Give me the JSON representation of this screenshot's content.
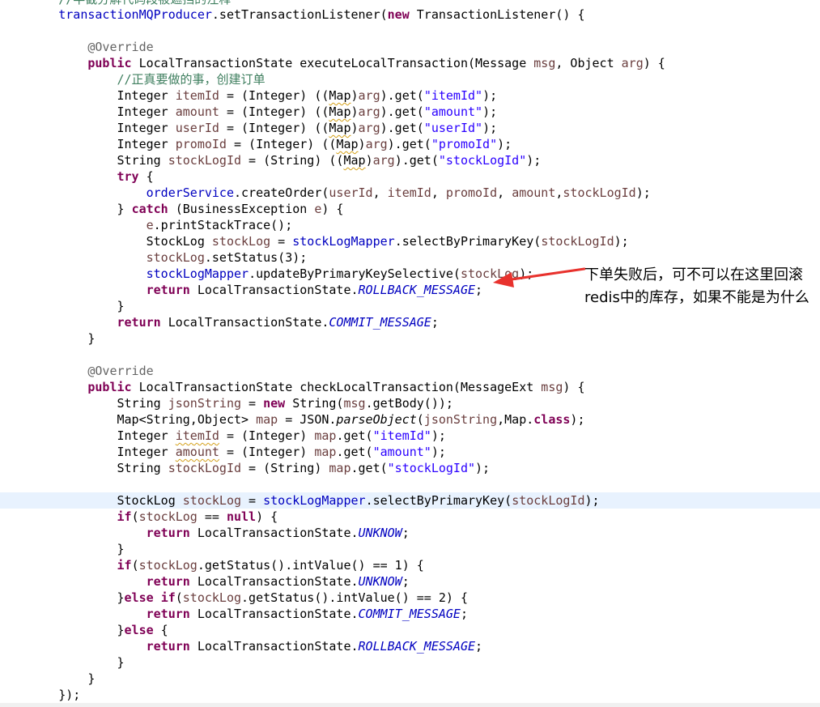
{
  "colors": {
    "keyword": "#7f0055",
    "field": "#0000c0",
    "string": "#2a00ff",
    "local_var": "#6a3e3e",
    "annotation": "#646464",
    "comment": "#3f7f5f",
    "current_line": "#e8f2fe",
    "arrow": "#e8322d"
  },
  "annotation": {
    "note": "下单失败后，可不可以在这里回滚redis中的库存，如果不能是为什么",
    "arrow_icon": "red-arrow-icon"
  },
  "code_lines": [
    [
      {
        "t": "        //半截分解代码段被遮挡的注释",
        "c": "cmt"
      }
    ],
    [
      {
        "t": "        "
      },
      {
        "t": "transactionMQProducer",
        "c": "fld"
      },
      {
        "t": ".setTransactionListener("
      },
      {
        "t": "new",
        "c": "kw"
      },
      {
        "t": " TransactionListener() {"
      }
    ],
    [],
    [
      {
        "t": "            "
      },
      {
        "t": "@Override",
        "c": "ann"
      }
    ],
    [
      {
        "t": "            "
      },
      {
        "t": "public",
        "c": "kw"
      },
      {
        "t": " LocalTransactionState executeLocalTransaction(Message "
      },
      {
        "t": "msg",
        "c": "loc"
      },
      {
        "t": ", Object "
      },
      {
        "t": "arg",
        "c": "loc"
      },
      {
        "t": ") {"
      }
    ],
    [
      {
        "t": "                "
      },
      {
        "t": "//正真要做的事，创建订单",
        "c": "cmt"
      }
    ],
    [
      {
        "t": "                Integer "
      },
      {
        "t": "itemId",
        "c": "loc"
      },
      {
        "t": " = (Integer) (("
      },
      {
        "t": "Map",
        "c": "warn"
      },
      {
        "t": ")"
      },
      {
        "t": "arg",
        "c": "loc"
      },
      {
        "t": ").get("
      },
      {
        "t": "\"itemId\"",
        "c": "str"
      },
      {
        "t": ");"
      }
    ],
    [
      {
        "t": "                Integer "
      },
      {
        "t": "amount",
        "c": "loc"
      },
      {
        "t": " = (Integer) (("
      },
      {
        "t": "Map",
        "c": "warn"
      },
      {
        "t": ")"
      },
      {
        "t": "arg",
        "c": "loc"
      },
      {
        "t": ").get("
      },
      {
        "t": "\"amount\"",
        "c": "str"
      },
      {
        "t": ");"
      }
    ],
    [
      {
        "t": "                Integer "
      },
      {
        "t": "userId",
        "c": "loc"
      },
      {
        "t": " = (Integer) (("
      },
      {
        "t": "Map",
        "c": "warn"
      },
      {
        "t": ")"
      },
      {
        "t": "arg",
        "c": "loc"
      },
      {
        "t": ").get("
      },
      {
        "t": "\"userId\"",
        "c": "str"
      },
      {
        "t": ");"
      }
    ],
    [
      {
        "t": "                Integer "
      },
      {
        "t": "promoId",
        "c": "loc"
      },
      {
        "t": " = (Integer) (("
      },
      {
        "t": "Map",
        "c": "warn"
      },
      {
        "t": ")"
      },
      {
        "t": "arg",
        "c": "loc"
      },
      {
        "t": ").get("
      },
      {
        "t": "\"promoId\"",
        "c": "str"
      },
      {
        "t": ");"
      }
    ],
    [
      {
        "t": "                String "
      },
      {
        "t": "stockLogId",
        "c": "loc"
      },
      {
        "t": " = (String) (("
      },
      {
        "t": "Map",
        "c": "warn"
      },
      {
        "t": ")"
      },
      {
        "t": "arg",
        "c": "loc"
      },
      {
        "t": ").get("
      },
      {
        "t": "\"stockLogId\"",
        "c": "str"
      },
      {
        "t": ");"
      }
    ],
    [
      {
        "t": "                "
      },
      {
        "t": "try",
        "c": "kw"
      },
      {
        "t": " {"
      }
    ],
    [
      {
        "t": "                    "
      },
      {
        "t": "orderService",
        "c": "fld"
      },
      {
        "t": ".createOrder("
      },
      {
        "t": "userId",
        "c": "loc"
      },
      {
        "t": ", "
      },
      {
        "t": "itemId",
        "c": "loc"
      },
      {
        "t": ", "
      },
      {
        "t": "promoId",
        "c": "loc"
      },
      {
        "t": ", "
      },
      {
        "t": "amount",
        "c": "loc"
      },
      {
        "t": ","
      },
      {
        "t": "stockLogId",
        "c": "loc"
      },
      {
        "t": ");"
      }
    ],
    [
      {
        "t": "                } "
      },
      {
        "t": "catch",
        "c": "kw"
      },
      {
        "t": " (BusinessException "
      },
      {
        "t": "e",
        "c": "loc"
      },
      {
        "t": ") {"
      }
    ],
    [
      {
        "t": "                    "
      },
      {
        "t": "e",
        "c": "loc"
      },
      {
        "t": ".printStackTrace();"
      }
    ],
    [
      {
        "t": "                    StockLog "
      },
      {
        "t": "stockLog",
        "c": "loc"
      },
      {
        "t": " = "
      },
      {
        "t": "stockLogMapper",
        "c": "fld"
      },
      {
        "t": ".selectByPrimaryKey("
      },
      {
        "t": "stockLogId",
        "c": "loc"
      },
      {
        "t": ");"
      }
    ],
    [
      {
        "t": "                    "
      },
      {
        "t": "stockLog",
        "c": "loc"
      },
      {
        "t": ".setStatus(3);"
      }
    ],
    [
      {
        "t": "                    "
      },
      {
        "t": "stockLogMapper",
        "c": "fld"
      },
      {
        "t": ".updateByPrimaryKeySelective("
      },
      {
        "t": "stockLog",
        "c": "loc"
      },
      {
        "t": ");"
      }
    ],
    [
      {
        "t": "                    "
      },
      {
        "t": "return",
        "c": "kw"
      },
      {
        "t": " LocalTransactionState."
      },
      {
        "t": "ROLLBACK_MESSAGE",
        "c": "sfld"
      },
      {
        "t": ";"
      }
    ],
    [
      {
        "t": "                }"
      }
    ],
    [
      {
        "t": "                "
      },
      {
        "t": "return",
        "c": "kw"
      },
      {
        "t": " LocalTransactionState."
      },
      {
        "t": "COMMIT_MESSAGE",
        "c": "sfld"
      },
      {
        "t": ";"
      }
    ],
    [
      {
        "t": "            }"
      }
    ],
    [],
    [
      {
        "t": "            "
      },
      {
        "t": "@Override",
        "c": "ann"
      }
    ],
    [
      {
        "t": "            "
      },
      {
        "t": "public",
        "c": "kw"
      },
      {
        "t": " LocalTransactionState checkLocalTransaction(MessageExt "
      },
      {
        "t": "msg",
        "c": "loc"
      },
      {
        "t": ") {"
      }
    ],
    [
      {
        "t": "                String "
      },
      {
        "t": "jsonString",
        "c": "loc"
      },
      {
        "t": " = "
      },
      {
        "t": "new",
        "c": "kw"
      },
      {
        "t": " String("
      },
      {
        "t": "msg",
        "c": "loc"
      },
      {
        "t": ".getBody());"
      }
    ],
    [
      {
        "t": "                Map<String,Object> "
      },
      {
        "t": "map",
        "c": "loc"
      },
      {
        "t": " = JSON."
      },
      {
        "t": "parseObject",
        "c": "mth"
      },
      {
        "t": "("
      },
      {
        "t": "jsonString",
        "c": "loc"
      },
      {
        "t": ",Map."
      },
      {
        "t": "class",
        "c": "kw"
      },
      {
        "t": ");"
      }
    ],
    [
      {
        "t": "                Integer "
      },
      {
        "t": "itemId",
        "c": "loc warn"
      },
      {
        "t": " = (Integer) "
      },
      {
        "t": "map",
        "c": "loc"
      },
      {
        "t": ".get("
      },
      {
        "t": "\"itemId\"",
        "c": "str"
      },
      {
        "t": ");"
      }
    ],
    [
      {
        "t": "                Integer "
      },
      {
        "t": "amount",
        "c": "loc warn"
      },
      {
        "t": " = (Integer) "
      },
      {
        "t": "map",
        "c": "loc"
      },
      {
        "t": ".get("
      },
      {
        "t": "\"amount\"",
        "c": "str"
      },
      {
        "t": ");"
      }
    ],
    [
      {
        "t": "                String "
      },
      {
        "t": "stockLogId",
        "c": "loc"
      },
      {
        "t": " = (String) "
      },
      {
        "t": "map",
        "c": "loc"
      },
      {
        "t": ".get("
      },
      {
        "t": "\"stockLogId\"",
        "c": "str"
      },
      {
        "t": ");"
      }
    ],
    [],
    [
      {
        "t": "                StockLog "
      },
      {
        "t": "stockLog",
        "c": "loc"
      },
      {
        "t": " = "
      },
      {
        "t": "stockLogMapper",
        "c": "fld"
      },
      {
        "t": ".selectByPrimaryKey("
      },
      {
        "t": "stockLogId",
        "c": "loc"
      },
      {
        "t": ");"
      }
    ],
    [
      {
        "t": "                "
      },
      {
        "t": "if",
        "c": "kw"
      },
      {
        "t": "("
      },
      {
        "t": "stockLog",
        "c": "loc"
      },
      {
        "t": " == "
      },
      {
        "t": "null",
        "c": "kw"
      },
      {
        "t": ") {"
      }
    ],
    [
      {
        "t": "                    "
      },
      {
        "t": "return",
        "c": "kw"
      },
      {
        "t": " LocalTransactionState."
      },
      {
        "t": "UNKNOW",
        "c": "sfld"
      },
      {
        "t": ";"
      }
    ],
    [
      {
        "t": "                }"
      }
    ],
    [
      {
        "t": "                "
      },
      {
        "t": "if",
        "c": "kw"
      },
      {
        "t": "("
      },
      {
        "t": "stockLog",
        "c": "loc"
      },
      {
        "t": ".getStatus().intValue() == 1) {"
      }
    ],
    [
      {
        "t": "                    "
      },
      {
        "t": "return",
        "c": "kw"
      },
      {
        "t": " LocalTransactionState."
      },
      {
        "t": "UNKNOW",
        "c": "sfld"
      },
      {
        "t": ";"
      }
    ],
    [
      {
        "t": "                }"
      },
      {
        "t": "else",
        "c": "kw"
      },
      {
        "t": " "
      },
      {
        "t": "if",
        "c": "kw"
      },
      {
        "t": "("
      },
      {
        "t": "stockLog",
        "c": "loc"
      },
      {
        "t": ".getStatus().intValue() == 2) {"
      }
    ],
    [
      {
        "t": "                    "
      },
      {
        "t": "return",
        "c": "kw"
      },
      {
        "t": " LocalTransactionState."
      },
      {
        "t": "COMMIT_MESSAGE",
        "c": "sfld"
      },
      {
        "t": ";"
      }
    ],
    [
      {
        "t": "                }"
      },
      {
        "t": "else",
        "c": "kw"
      },
      {
        "t": " {"
      }
    ],
    [
      {
        "t": "                    "
      },
      {
        "t": "return",
        "c": "kw"
      },
      {
        "t": " LocalTransactionState."
      },
      {
        "t": "ROLLBACK_MESSAGE",
        "c": "sfld"
      },
      {
        "t": ";"
      }
    ],
    [
      {
        "t": "                }"
      }
    ],
    [
      {
        "t": "            }"
      }
    ],
    [
      {
        "t": "        });"
      }
    ]
  ]
}
